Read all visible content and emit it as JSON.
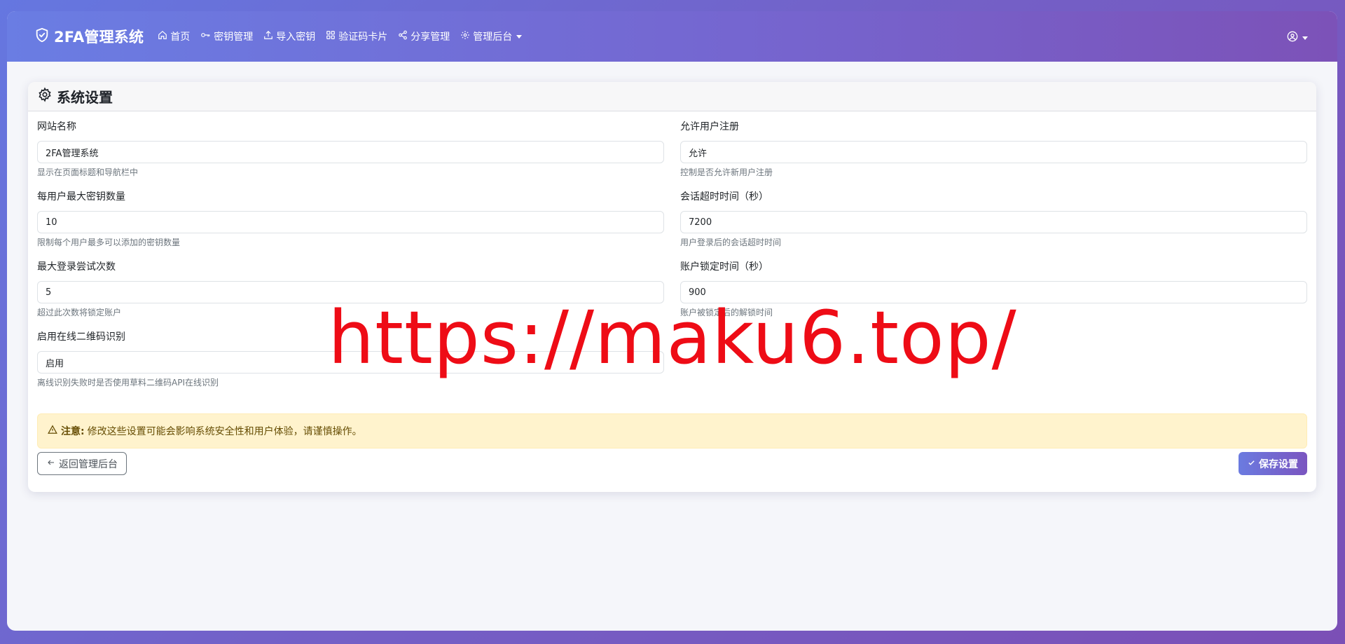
{
  "navbar": {
    "brand": "2FA管理系统",
    "items": [
      {
        "label": "首页",
        "icon": "home-icon"
      },
      {
        "label": "密钥管理",
        "icon": "key-icon"
      },
      {
        "label": "导入密钥",
        "icon": "upload-icon"
      },
      {
        "label": "验证码卡片",
        "icon": "grid-icon"
      },
      {
        "label": "分享管理",
        "icon": "share-icon"
      },
      {
        "label": "管理后台",
        "icon": "gear-icon"
      }
    ],
    "user_icon": "user-circle-icon"
  },
  "settings": {
    "title": "系统设置",
    "fields": [
      {
        "label": "网站名称",
        "value": "2FA管理系统",
        "help": "显示在页面标题和导航栏中"
      },
      {
        "label": "允许用户注册",
        "value": "允许",
        "help": "控制是否允许新用户注册"
      },
      {
        "label": "每用户最大密钥数量",
        "value": "10",
        "help": "限制每个用户最多可以添加的密钥数量"
      },
      {
        "label": "会话超时时间（秒）",
        "value": "7200",
        "help": "用户登录后的会话超时时间"
      },
      {
        "label": "最大登录尝试次数",
        "value": "5",
        "help": "超过此次数将锁定账户"
      },
      {
        "label": "账户锁定时间（秒）",
        "value": "900",
        "help": "账户被锁定后的解锁时间"
      },
      {
        "label": "启用在线二维码识别",
        "value": "启用",
        "help": "离线识别失败时是否使用草料二维码API在线识别"
      }
    ],
    "alert": {
      "strong": "注意:",
      "text": "修改这些设置可能会影响系统安全性和用户体验，请谨慎操作。"
    },
    "back_label": "返回管理后台",
    "save_label": "保存设置"
  },
  "watermark": "https://maku6.top/",
  "colors": {
    "accent": "#6a7de3",
    "accent_end": "#7c52b8",
    "alert_bg": "#fff3cd",
    "watermark": "#ee0c16"
  }
}
